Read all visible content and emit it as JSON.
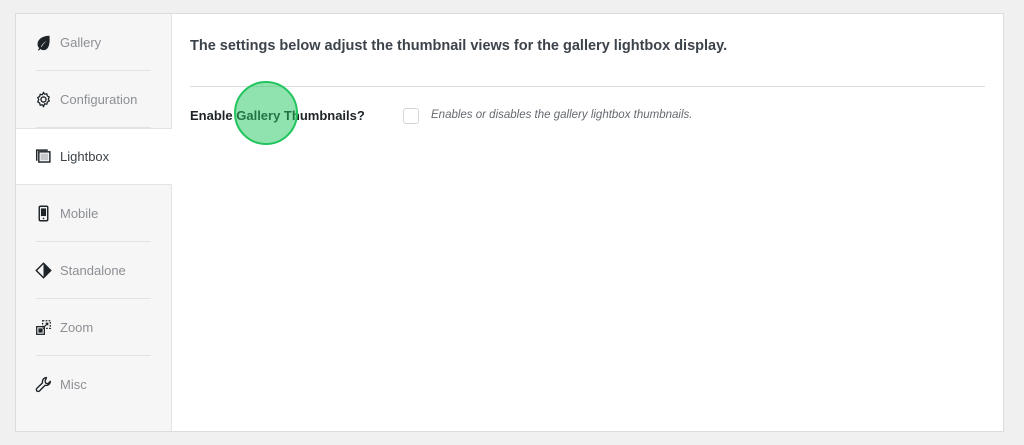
{
  "sidebar": {
    "items": [
      {
        "label": "Gallery",
        "icon": "leaf-icon",
        "active": false
      },
      {
        "label": "Configuration",
        "icon": "gear-icon",
        "active": false
      },
      {
        "label": "Lightbox",
        "icon": "lightbox-icon",
        "active": true
      },
      {
        "label": "Mobile",
        "icon": "mobile-icon",
        "active": false
      },
      {
        "label": "Standalone",
        "icon": "diamond-icon",
        "active": false
      },
      {
        "label": "Zoom",
        "icon": "zoom-icon",
        "active": false
      },
      {
        "label": "Misc",
        "icon": "wrench-icon",
        "active": false
      }
    ]
  },
  "main": {
    "heading": "The settings below adjust the thumbnail views for the gallery lightbox display.",
    "setting": {
      "label": "Enable Gallery Thumbnails?",
      "checked": false,
      "description": "Enables or disables the gallery lightbox thumbnails."
    }
  },
  "colors": {
    "click_marker": "#22c55e",
    "sidebar_bg": "#f6f6f6",
    "page_bg": "#f0f0f1"
  }
}
